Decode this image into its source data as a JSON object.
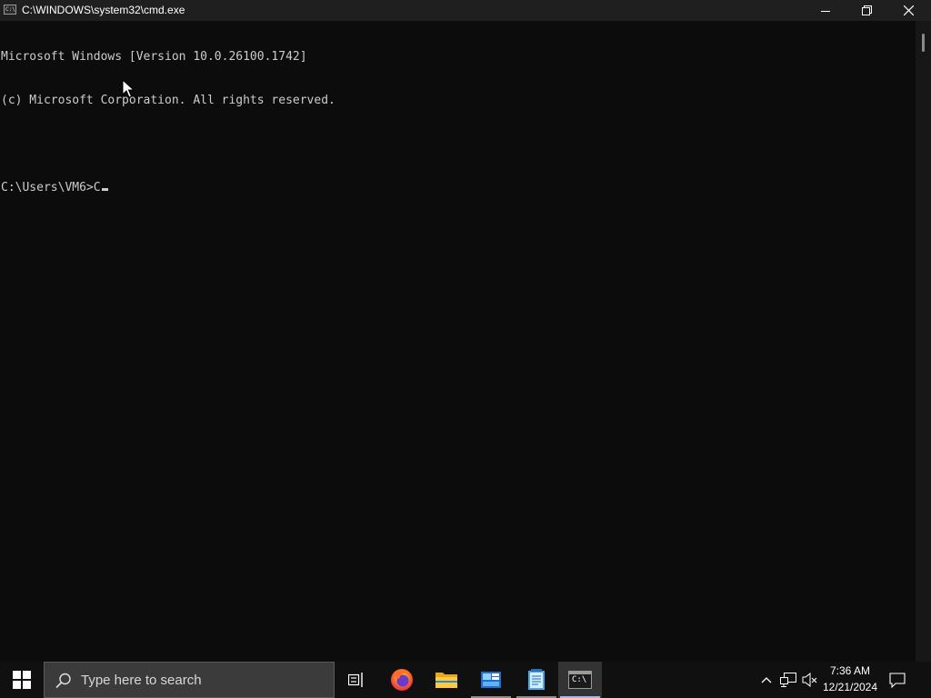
{
  "window": {
    "title": "C:\\WINDOWS\\system32\\cmd.exe",
    "icon_label": "C:\\",
    "controls": [
      "minimize-icon",
      "restore-icon",
      "close-icon"
    ]
  },
  "console": {
    "lines": [
      "Microsoft Windows [Version 10.0.26100.1742]",
      "(c) Microsoft Corporation. All rights reserved.",
      "",
      "C:\\Users\\VM6>C"
    ],
    "background": "#0c0c0c",
    "foreground": "#cccccc"
  },
  "taskbar": {
    "search_placeholder": "Type here to search",
    "apps": [
      {
        "name": "task-view",
        "icon": "task-view-icon"
      },
      {
        "name": "firefox",
        "icon": "firefox-icon"
      },
      {
        "name": "file-explorer",
        "icon": "folder-icon"
      },
      {
        "name": "control-panel",
        "icon": "control-panel-icon"
      },
      {
        "name": "notepad",
        "icon": "notepad-icon"
      },
      {
        "name": "command-prompt",
        "icon": "cmd-icon",
        "active": true
      }
    ],
    "cmd_icon_label": "C:\\",
    "tray": {
      "time": "7:36 AM",
      "date": "12/21/2024"
    }
  }
}
